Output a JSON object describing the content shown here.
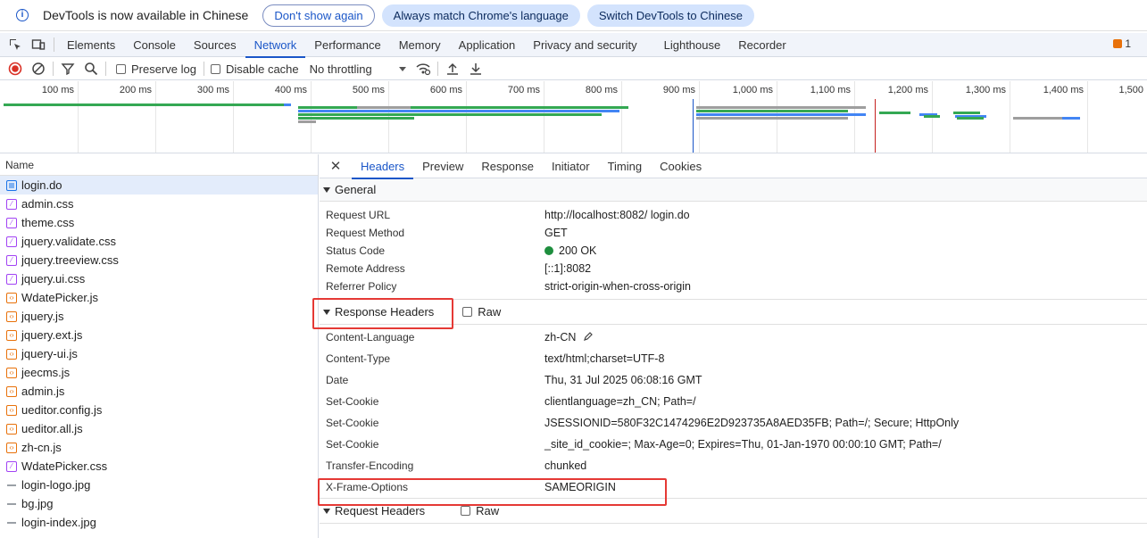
{
  "infobar": {
    "message": "DevTools is now available in Chinese",
    "dont_show": "Don't show again",
    "match_lang": "Always match Chrome's language",
    "switch_lang": "Switch DevTools to Chinese"
  },
  "tabs": [
    "Elements",
    "Console",
    "Sources",
    "Network",
    "Performance",
    "Memory",
    "Application",
    "Privacy and security",
    "Lighthouse",
    "Recorder"
  ],
  "issues_count": "1",
  "toolbar": {
    "preserve_log": "Preserve log",
    "disable_cache": "Disable cache",
    "throttling": "No throttling"
  },
  "timeline_ticks": [
    "100 ms",
    "200 ms",
    "300 ms",
    "400 ms",
    "500 ms",
    "600 ms",
    "700 ms",
    "800 ms",
    "900 ms",
    "1,000 ms",
    "1,100 ms",
    "1,200 ms",
    "1,300 ms",
    "1,400 ms",
    "1,500"
  ],
  "name_header": "Name",
  "files": [
    {
      "name": "login.do",
      "type": "doc"
    },
    {
      "name": "admin.css",
      "type": "css"
    },
    {
      "name": "theme.css",
      "type": "css"
    },
    {
      "name": "jquery.validate.css",
      "type": "css"
    },
    {
      "name": "jquery.treeview.css",
      "type": "css"
    },
    {
      "name": "jquery.ui.css",
      "type": "css"
    },
    {
      "name": "WdatePicker.js",
      "type": "js"
    },
    {
      "name": "jquery.js",
      "type": "js"
    },
    {
      "name": "jquery.ext.js",
      "type": "js"
    },
    {
      "name": "jquery-ui.js",
      "type": "js"
    },
    {
      "name": "jeecms.js",
      "type": "js"
    },
    {
      "name": "admin.js",
      "type": "js"
    },
    {
      "name": "ueditor.config.js",
      "type": "js"
    },
    {
      "name": "ueditor.all.js",
      "type": "js"
    },
    {
      "name": "zh-cn.js",
      "type": "js"
    },
    {
      "name": "WdatePicker.css",
      "type": "css"
    },
    {
      "name": "login-logo.jpg",
      "type": "img"
    },
    {
      "name": "bg.jpg",
      "type": "img"
    },
    {
      "name": "login-index.jpg",
      "type": "img"
    }
  ],
  "detail_tabs": [
    "Headers",
    "Preview",
    "Response",
    "Initiator",
    "Timing",
    "Cookies"
  ],
  "general": {
    "title": "General",
    "rows": [
      {
        "k": "Request URL",
        "v": "http://localhost:8082/      login.do"
      },
      {
        "k": "Request Method",
        "v": "GET"
      },
      {
        "k": "Status Code",
        "v": "200 OK"
      },
      {
        "k": "Remote Address",
        "v": "[::1]:8082"
      },
      {
        "k": "Referrer Policy",
        "v": "strict-origin-when-cross-origin"
      }
    ]
  },
  "response_headers": {
    "title": "Response Headers",
    "raw": "Raw",
    "rows": [
      {
        "k": "Content-Language",
        "v": "zh-CN"
      },
      {
        "k": "Content-Type",
        "v": "text/html;charset=UTF-8"
      },
      {
        "k": "Date",
        "v": "Thu, 31 Jul 2025 06:08:16 GMT"
      },
      {
        "k": "Set-Cookie",
        "v": "clientlanguage=zh_CN; Path=/"
      },
      {
        "k": "Set-Cookie",
        "v": "JSESSIONID=580F32C1474296E2D923735A8AED35FB; Path=/; Secure; HttpOnly"
      },
      {
        "k": "Set-Cookie",
        "v": "_site_id_cookie=; Max-Age=0; Expires=Thu, 01-Jan-1970 00:00:10 GMT; Path=/"
      },
      {
        "k": "Transfer-Encoding",
        "v": "chunked"
      },
      {
        "k": "X-Frame-Options",
        "v": "SAMEORIGIN"
      }
    ]
  },
  "request_headers": {
    "title": "Request Headers",
    "raw": "Raw"
  },
  "colors": {
    "accent": "#1a56c8",
    "highlight_box": "#e53935",
    "status_ok": "#1e8e3e"
  }
}
